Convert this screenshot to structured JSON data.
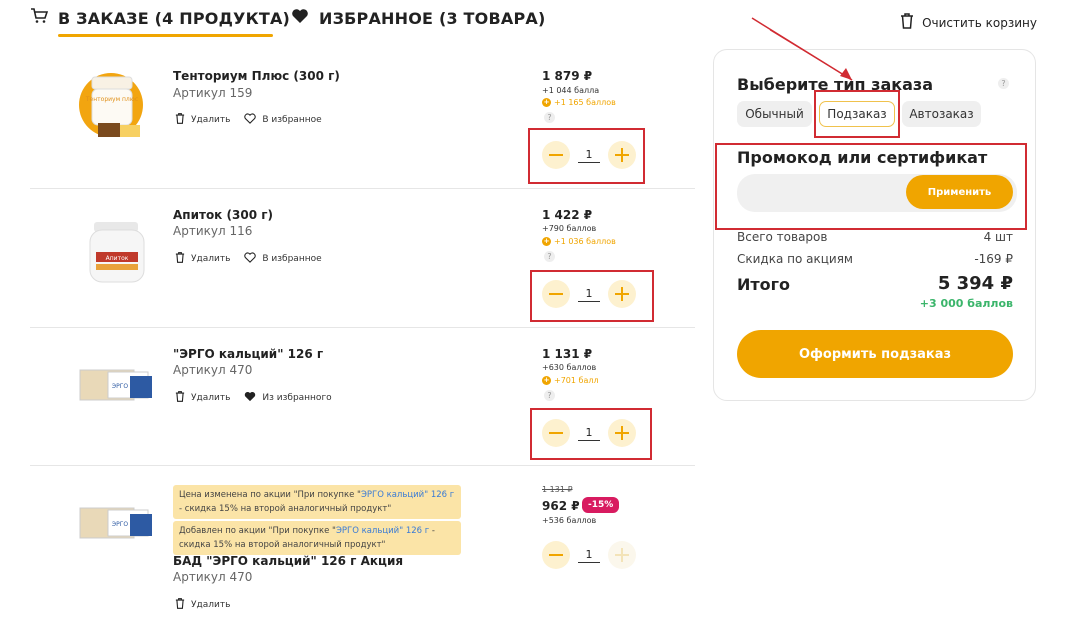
{
  "tabs": [
    {
      "label": "В ЗАКАЗЕ (4 ПРОДУКТА)",
      "icon": "cart-icon"
    },
    {
      "label": "ИЗБРАННОЕ (3 ТОВАРА)",
      "icon": "heart-icon"
    }
  ],
  "clear_cart": {
    "label": "Очистить корзину",
    "icon": "trash-icon"
  },
  "products": [
    {
      "name": "Тенториум Плюс (300 г)",
      "article": "Артикул 159",
      "delete_label": "Удалить",
      "fav_label": "В избранное",
      "price": "1 879 ₽",
      "bonus": "+1 044 балла",
      "bonus_extra": "+1 165 баллов",
      "qty": "1"
    },
    {
      "name": "Апиток (300 г)",
      "article": "Артикул 116",
      "delete_label": "Удалить",
      "fav_label": "В избранное",
      "price": "1 422 ₽",
      "bonus": "+790 баллов",
      "bonus_extra": "+1 036 баллов",
      "qty": "1"
    },
    {
      "name": "\"ЭРГО кальций\" 126 г",
      "article": "Артикул 470",
      "delete_label": "Удалить",
      "fav_label": "Из избранного",
      "price": "1 131 ₽",
      "bonus": "+630 баллов",
      "bonus_extra": "+701 балл",
      "qty": "1"
    },
    {
      "name": "БАД \"ЭРГО кальций\" 126 г Акция",
      "article": "Артикул 470",
      "delete_label": "Удалить",
      "old_price": "1 131 ₽",
      "price": "962 ₽",
      "discount": "-15%",
      "bonus": "+536 баллов",
      "qty": "1",
      "notice1": {
        "pre": "Цена изменена по акции \"При покупке \"",
        "link": "ЭРГО кальций\" 126 г",
        "post": " - скидка 15% на второй аналогичный продукт\""
      },
      "notice2": {
        "pre": "Добавлен по акции \"При покупке \"",
        "link": "ЭРГО кальций\" 126 г",
        "post": " - скидка 15% на второй аналогичный продукт\""
      }
    }
  ],
  "product_images": [
    {
      "label": "Тенториум плюс"
    },
    {
      "label": "Апиток"
    },
    {
      "label": "ЭРГО"
    },
    {
      "label": "ЭРГО"
    }
  ],
  "order_panel": {
    "title": "Выберите тип заказа",
    "help": "?",
    "types": [
      "Обычный",
      "Подзаказ",
      "Автозаказ"
    ],
    "selected_type": "Подзаказ",
    "promo_title": "Промокод или сертификат",
    "promo_value": "",
    "apply_label": "Применить",
    "total_items_label": "Всего товаров",
    "total_items_value": "4 шт",
    "discount_label": "Скидка по акциям",
    "discount_value": "-169 ₽",
    "total_label": "Итого",
    "total_value": "5 394 ₽",
    "total_bonus": "+3 000 баллов",
    "checkout_label": "Оформить подзаказ"
  },
  "colors": {
    "accent": "#f0a500",
    "accent_light": "#fdf1cf",
    "annotation_red": "#d12b32",
    "bonus_green": "#3bb56b",
    "discount_pink": "#d81b60"
  }
}
